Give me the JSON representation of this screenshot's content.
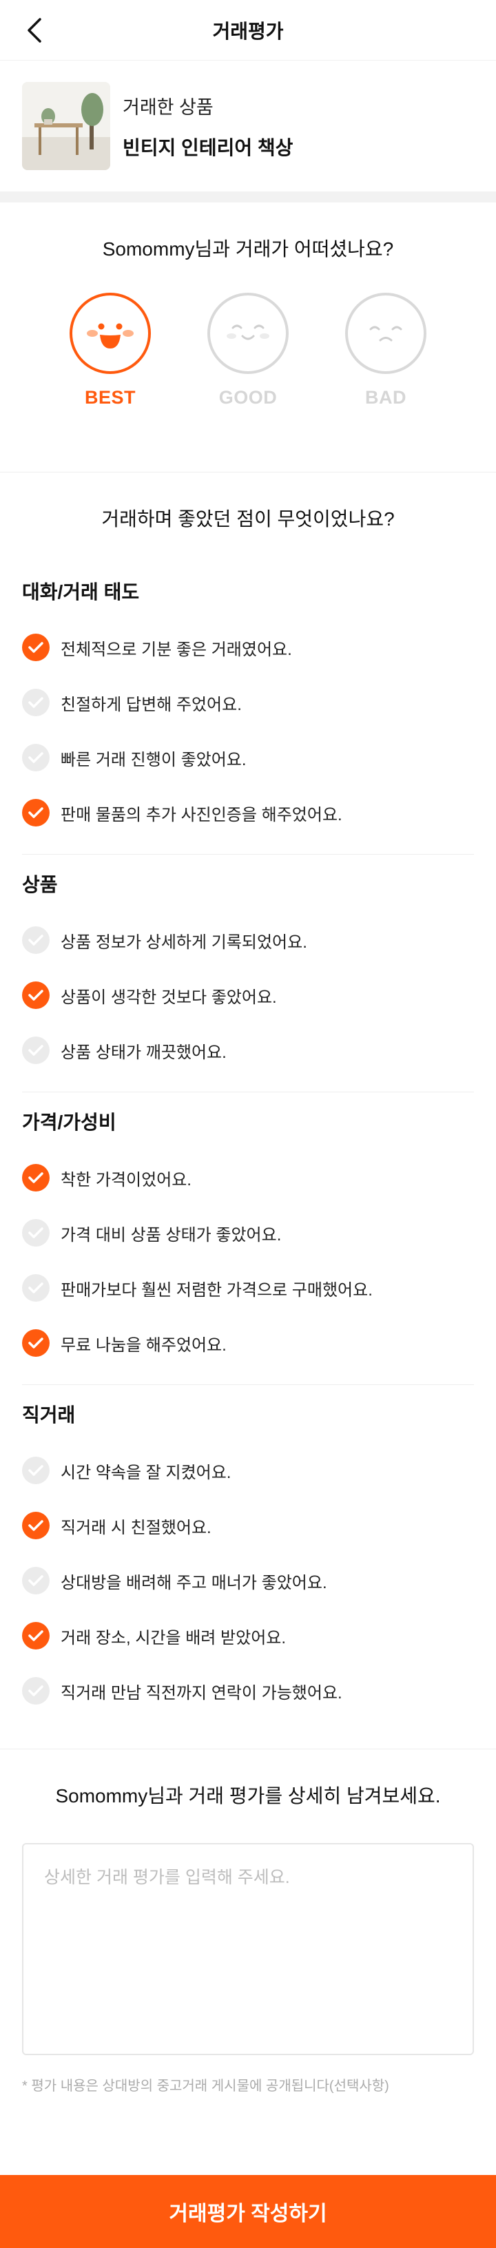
{
  "header": {
    "title": "거래평가"
  },
  "product": {
    "label": "거래한 상품",
    "name": "빈티지 인테리어 책상"
  },
  "rating": {
    "question": "Somommy님과 거래가 어떠셨나요?",
    "options": [
      {
        "label": "BEST",
        "selected": true
      },
      {
        "label": "GOOD",
        "selected": false
      },
      {
        "label": "BAD",
        "selected": false
      }
    ]
  },
  "good_points": {
    "question": "거래하며 좋았던 점이 무엇이었나요?",
    "categories": [
      {
        "title": "대화/거래 태도",
        "items": [
          {
            "text": "전체적으로 기분 좋은 거래였어요.",
            "checked": true
          },
          {
            "text": "친절하게 답변해 주었어요.",
            "checked": false
          },
          {
            "text": "빠른 거래 진행이 좋았어요.",
            "checked": false
          },
          {
            "text": "판매 물품의 추가 사진인증을 해주었어요.",
            "checked": true
          }
        ]
      },
      {
        "title": "상품",
        "items": [
          {
            "text": "상품 정보가 상세하게 기록되었어요.",
            "checked": false
          },
          {
            "text": "상품이 생각한 것보다 좋았어요.",
            "checked": true
          },
          {
            "text": "상품 상태가 깨끗했어요.",
            "checked": false
          }
        ]
      },
      {
        "title": "가격/가성비",
        "items": [
          {
            "text": "착한 가격이었어요.",
            "checked": true
          },
          {
            "text": "가격 대비 상품 상태가 좋았어요.",
            "checked": false
          },
          {
            "text": "판매가보다 훨씬 저렴한 가격으로 구매했어요.",
            "checked": false
          },
          {
            "text": "무료 나눔을 해주었어요.",
            "checked": true
          }
        ]
      },
      {
        "title": "직거래",
        "items": [
          {
            "text": "시간 약속을 잘 지켰어요.",
            "checked": false
          },
          {
            "text": "직거래 시 친절했어요.",
            "checked": true
          },
          {
            "text": "상대방을 배려해 주고 매너가 좋았어요.",
            "checked": false
          },
          {
            "text": "거래 장소, 시간을 배려 받았어요.",
            "checked": true
          },
          {
            "text": "직거래 만남 직전까지 연락이 가능했어요.",
            "checked": false
          }
        ]
      }
    ]
  },
  "detail": {
    "question": "Somommy님과 거래 평가를 상세히 남겨보세요.",
    "placeholder": "상세한 거래 평가를 입력해 주세요.",
    "value": "",
    "note": "* 평가 내용은 상대방의 중고거래 게시물에 공개됩니다(선택사항)"
  },
  "submit": {
    "label": "거래평가 작성하기"
  },
  "colors": {
    "accent": "#ff5a0e",
    "inactive": "#d6d6d6",
    "check_off": "#ebebeb"
  },
  "icons": {
    "back": "chevron-left-icon",
    "check": "check-icon"
  }
}
